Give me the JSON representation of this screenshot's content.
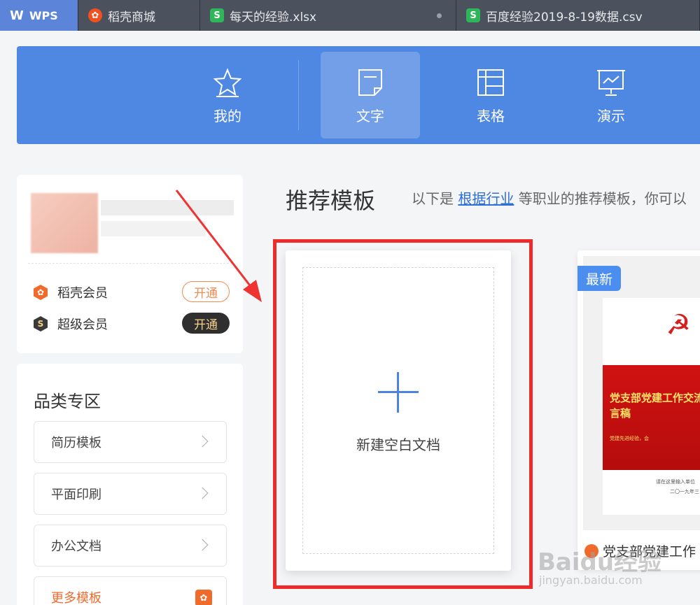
{
  "tabs": [
    {
      "label": "WPS",
      "icon": "wps-logo-icon"
    },
    {
      "label": "稻壳商城",
      "icon": "docer-icon"
    },
    {
      "label": "每天的经验.xlsx",
      "icon": "sheet-file-icon"
    },
    {
      "label": "百度经验2019-8-19数据.csv",
      "icon": "sheet-file-icon"
    }
  ],
  "header": {
    "nav": [
      {
        "label": "我的",
        "icon": "star-icon"
      },
      {
        "label": "文字",
        "icon": "document-icon",
        "active": true
      },
      {
        "label": "表格",
        "icon": "table-icon"
      },
      {
        "label": "演示",
        "icon": "presentation-icon"
      }
    ]
  },
  "profile": {
    "members": [
      {
        "label": "稻壳会员",
        "action": "开通",
        "color": "#f06a2c"
      },
      {
        "label": "超级会员",
        "action": "开通",
        "color": "#2f2f2f"
      }
    ]
  },
  "categories": {
    "title": "品类专区",
    "items": [
      "简历模板",
      "平面印刷",
      "办公文档"
    ],
    "more": "更多模板"
  },
  "recommend": {
    "title": "推荐模板",
    "desc_prefix": "以下是",
    "desc_link": "根据行业",
    "desc_suffix": "等职业的推荐模板，你可以",
    "blank_label": "新建空白文档",
    "template": {
      "badge": "最新",
      "image_title": "党支部党建工作交流发言稿",
      "image_subtitle": "党建先进经验，会",
      "image_foot1": "请在这里输入单位",
      "image_foot2": "二〇一九年三",
      "name": "党支部党建工作"
    }
  },
  "watermark": {
    "line1": "Baidu经验",
    "line2": "jingyan.baidu.com"
  },
  "colors": {
    "accent": "#4f88e3",
    "highlight": "#ee2a2a",
    "orange": "#f06a2c"
  }
}
